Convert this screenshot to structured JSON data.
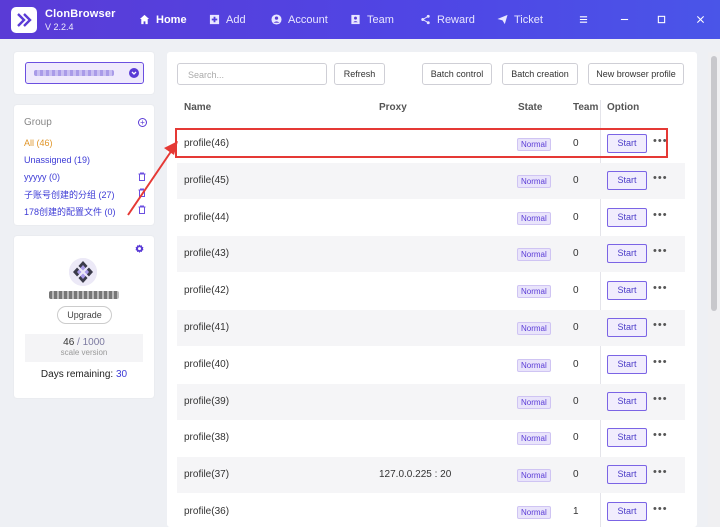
{
  "app": {
    "name": "ClonBrowser",
    "version": "V 2.2.4"
  },
  "nav": [
    {
      "label": "Home",
      "icon": "home-icon",
      "active": true
    },
    {
      "label": "Add",
      "icon": "plus-square-icon"
    },
    {
      "label": "Account",
      "icon": "user-circle-icon"
    },
    {
      "label": "Team",
      "icon": "team-icon"
    },
    {
      "label": "Reward",
      "icon": "share-icon"
    },
    {
      "label": "Ticket",
      "icon": "send-icon"
    }
  ],
  "group": {
    "title": "Group",
    "items": [
      {
        "label": "All  (46)"
      },
      {
        "label": "Unassigned  (19)"
      },
      {
        "label": "yyyyy  (0)"
      },
      {
        "label": "子账号创建的分组  (27)"
      },
      {
        "label": "178创建的配置文件  (0)"
      }
    ]
  },
  "profile_card": {
    "upgrade_label": "Upgrade",
    "quota_used": "46",
    "quota_sep": " / ",
    "quota_total": "1000",
    "quota_caption": "scale version",
    "days_label": "Days remaining: ",
    "days_value": "30"
  },
  "toolbar": {
    "search_placeholder": "Search...",
    "refresh": "Refresh",
    "batch_control": "Batch control",
    "batch_creation": "Batch creation",
    "new_profile": "New browser profile"
  },
  "table": {
    "headers": {
      "name": "Name",
      "proxy": "Proxy",
      "state": "State",
      "team": "Team",
      "option": "Option"
    },
    "rows": [
      {
        "name": "profile(46)",
        "proxy": "",
        "state": "Normal",
        "team": "0",
        "action": "Start",
        "more": "•••"
      },
      {
        "name": "profile(45)",
        "proxy": "",
        "state": "Normal",
        "team": "0",
        "action": "Start",
        "more": "•••"
      },
      {
        "name": "profile(44)",
        "proxy": "",
        "state": "Normal",
        "team": "0",
        "action": "Start",
        "more": "•••"
      },
      {
        "name": "profile(43)",
        "proxy": "",
        "state": "Normal",
        "team": "0",
        "action": "Start",
        "more": "•••"
      },
      {
        "name": "profile(42)",
        "proxy": "",
        "state": "Normal",
        "team": "0",
        "action": "Start",
        "more": "•••"
      },
      {
        "name": "profile(41)",
        "proxy": "",
        "state": "Normal",
        "team": "0",
        "action": "Start",
        "more": "•••"
      },
      {
        "name": "profile(40)",
        "proxy": "",
        "state": "Normal",
        "team": "0",
        "action": "Start",
        "more": "•••"
      },
      {
        "name": "profile(39)",
        "proxy": "",
        "state": "Normal",
        "team": "0",
        "action": "Start",
        "more": "•••"
      },
      {
        "name": "profile(38)",
        "proxy": "",
        "state": "Normal",
        "team": "0",
        "action": "Start",
        "more": "•••"
      },
      {
        "name": "profile(37)",
        "proxy": "127.0.0.225 : 20",
        "state": "Normal",
        "team": "0",
        "action": "Start",
        "more": "•••"
      },
      {
        "name": "profile(36)",
        "proxy": "",
        "state": "Normal",
        "team": "1",
        "action": "Start",
        "more": "•••"
      }
    ]
  },
  "colors": {
    "accent": "#5a3bd6",
    "highlight": "#e53935",
    "link": "#3c3ad6"
  }
}
